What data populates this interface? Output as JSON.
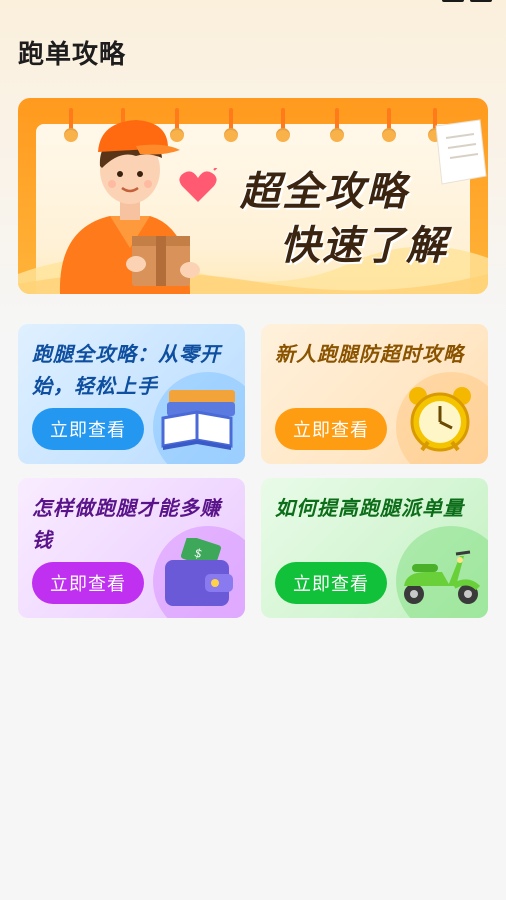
{
  "page": {
    "title": "跑单攻略"
  },
  "banner": {
    "line1": "超全攻略",
    "line2": "快速了解",
    "illustration": "courier-with-package",
    "accent_color": "#ff9a1e"
  },
  "cards": [
    {
      "title": "跑腿全攻略：从零开始，轻松上手",
      "button_label": "立即查看",
      "icon": "book-icon",
      "color": "#2497f0"
    },
    {
      "title": "新人跑腿防超时攻略",
      "button_label": "立即查看",
      "icon": "alarm-clock-icon",
      "color": "#ff9d12"
    },
    {
      "title": "怎样做跑腿才能多赚钱",
      "button_label": "立即查看",
      "icon": "wallet-icon",
      "color": "#c030f0"
    },
    {
      "title": "如何提高跑腿派单量",
      "button_label": "立即查看",
      "icon": "scooter-icon",
      "color": "#12c13a"
    }
  ]
}
